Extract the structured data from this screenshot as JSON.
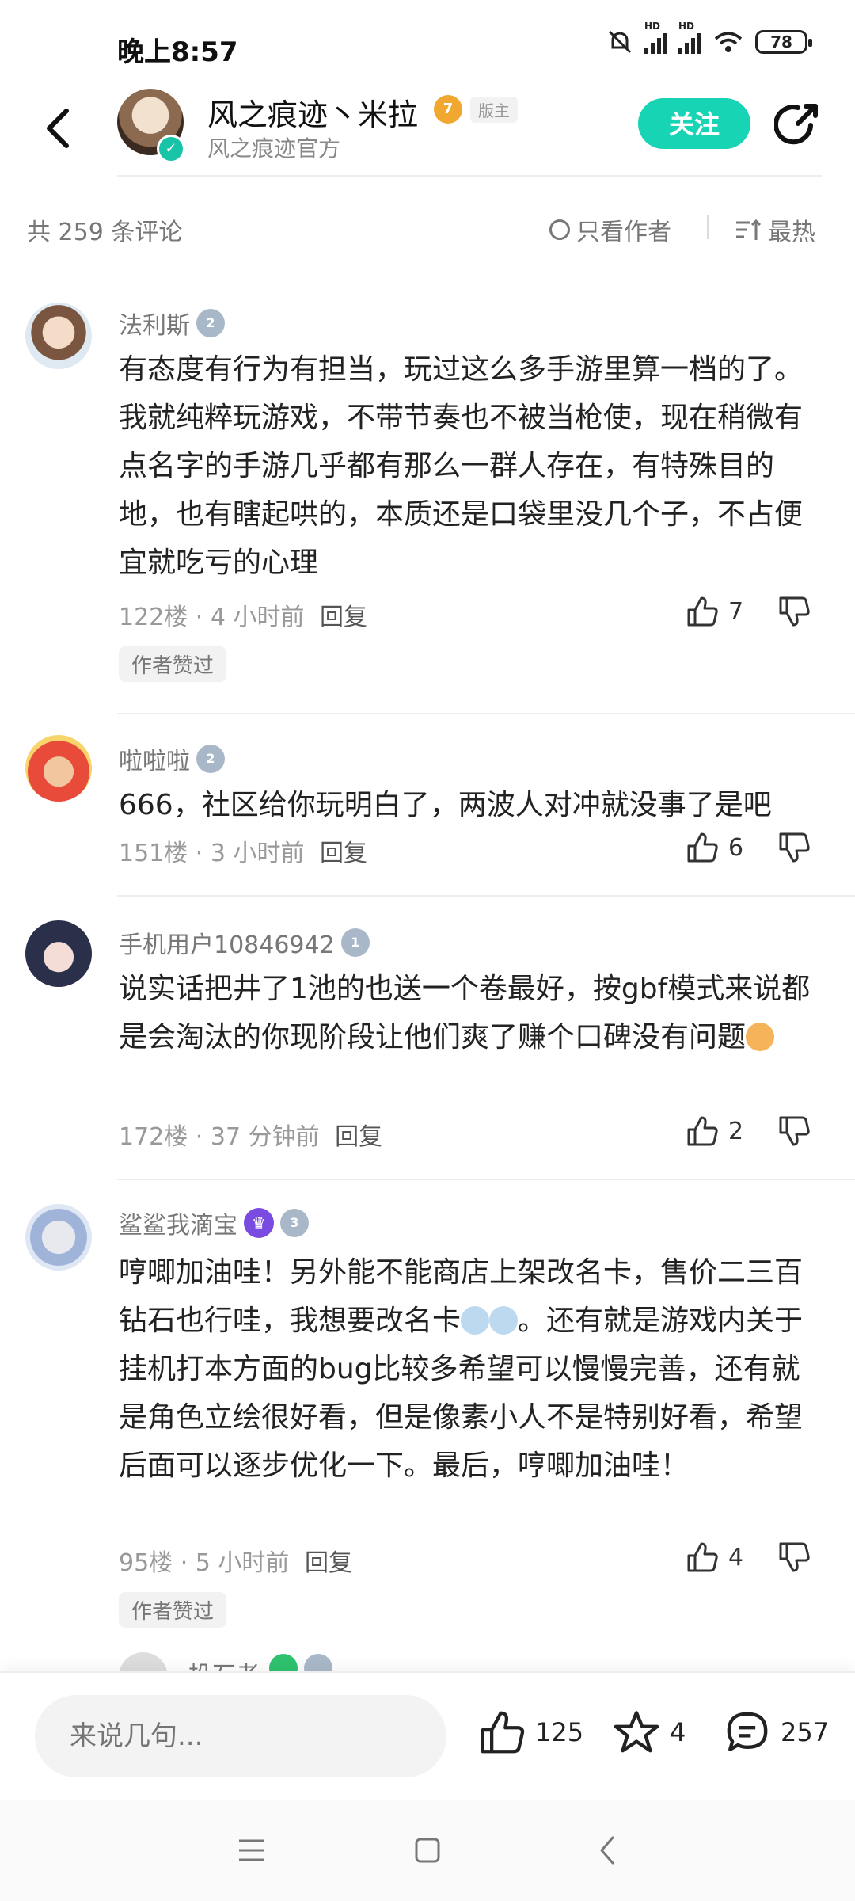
{
  "status_bar": {
    "time": "晚上8:57",
    "battery": "78",
    "network_label": "HD"
  },
  "header": {
    "author_name": "风之痕迹丶米拉",
    "author_level": "7",
    "mod_tag": "版主",
    "author_subtitle": "风之痕迹官方",
    "follow_label": "关注"
  },
  "toolbar": {
    "comment_count": "共 259 条评论",
    "only_author": "只看作者",
    "sort": "最热"
  },
  "comments": [
    {
      "name": "法利斯",
      "level": "2",
      "text": "有态度有行为有担当，玩过这么多手游里算一档的了。我就纯粹玩游戏，不带节奏也不被当枪使，现在稍微有点名字的手游几乎都有那么一群人存在，有特殊目的地，也有瞎起哄的，本质还是口袋里没几个子，不占便宜就吃亏的心理",
      "floor": "122楼",
      "time": "4 小时前",
      "reply": "回复",
      "likes": "7",
      "author_liked": "作者赞过"
    },
    {
      "name": "啦啦啦",
      "level": "2",
      "text": "666，社区给你玩明白了，两波人对冲就没事了是吧",
      "floor": "151楼",
      "time": "3 小时前",
      "reply": "回复",
      "likes": "6"
    },
    {
      "name": "手机用户10846942",
      "level": "1",
      "text": "说实话把井了1池的也送一个卷最好，按gbf模式来说都是会淘汰的你现阶段让他们爽了赚个口碑没有问题",
      "floor": "172楼",
      "time": "37 分钟前",
      "reply": "回复",
      "likes": "2"
    },
    {
      "name": "鲨鲨我滴宝",
      "level": "3",
      "text_a": "哼唧加油哇！另外能不能商店上架改名卡，售价二三百钻石也行哇，我想要改名卡",
      "text_b": "。还有就是游戏内关于挂机打本方面的bug比较多希望可以慢慢完善，还有就是角色立绘很好看，但是像素小人不是特别好看，希望后面可以逐步优化一下。最后，哼唧加油哇！",
      "floor": "95楼",
      "time": "5 小时前",
      "reply": "回复",
      "likes": "4",
      "author_liked": "作者赞过"
    }
  ],
  "peek_comment": {
    "name": "投石者"
  },
  "bottom_bar": {
    "input_placeholder": "来说几句...",
    "likes": "125",
    "favorites": "4",
    "comments": "257"
  },
  "colors": {
    "accent": "#17d4b4",
    "level_badge": "#a9b8c8",
    "gold_badge": "#f0a830"
  }
}
